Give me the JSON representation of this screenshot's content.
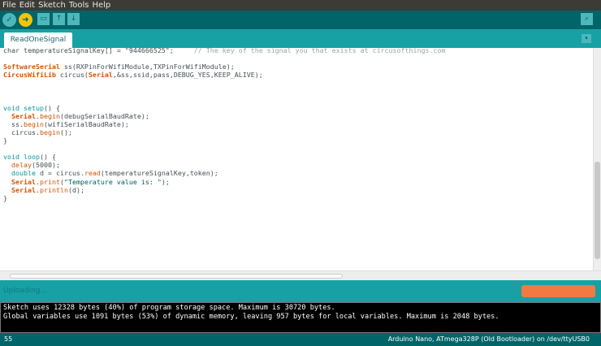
{
  "menu": [
    "File",
    "Edit",
    "Sketch",
    "Tools",
    "Help"
  ],
  "toolbar": {
    "verify": "✓",
    "upload": "➜",
    "new": "▭",
    "open": "↑",
    "save": "↓",
    "serial": "⌕"
  },
  "tab": {
    "label": "ReadOneSignal",
    "menu": "▾"
  },
  "code": [
    [
      {
        "t": "char temperatureSignalKey[] = \"944666525\";     ",
        "c": ""
      },
      {
        "t": "// The key of the signal you that exists at circusofthings.com",
        "c": "cm"
      }
    ],
    [],
    [
      {
        "t": "SoftwareSerial",
        "c": "cl"
      },
      {
        "t": " ss(RXPinForWifiModule,TXPinForWifiModule);",
        "c": ""
      }
    ],
    [
      {
        "t": "CircusWifiLib",
        "c": "cl"
      },
      {
        "t": " circus(",
        "c": ""
      },
      {
        "t": "Serial",
        "c": "cl"
      },
      {
        "t": ",&ss,ssid,pass,DEBUG_YES,KEEP_ALIVE);",
        "c": ""
      }
    ],
    [],
    [],
    [],
    [
      {
        "t": "void",
        "c": "kw"
      },
      {
        "t": " ",
        "c": ""
      },
      {
        "t": "setup",
        "c": "kw"
      },
      {
        "t": "() {",
        "c": ""
      }
    ],
    [
      {
        "t": "  ",
        "c": ""
      },
      {
        "t": "Serial",
        "c": "cl"
      },
      {
        "t": ".",
        "c": ""
      },
      {
        "t": "begin",
        "c": "fn"
      },
      {
        "t": "(debugSerialBaudRate);",
        "c": ""
      }
    ],
    [
      {
        "t": "  ss.",
        "c": ""
      },
      {
        "t": "begin",
        "c": "fn"
      },
      {
        "t": "(wifiSerialBaudRate);",
        "c": ""
      }
    ],
    [
      {
        "t": "  circus.",
        "c": ""
      },
      {
        "t": "begin",
        "c": "fn"
      },
      {
        "t": "();",
        "c": ""
      }
    ],
    [
      {
        "t": "}",
        "c": ""
      }
    ],
    [],
    [
      {
        "t": "void",
        "c": "kw"
      },
      {
        "t": " ",
        "c": ""
      },
      {
        "t": "loop",
        "c": "kw"
      },
      {
        "t": "() {",
        "c": ""
      }
    ],
    [
      {
        "t": "  ",
        "c": ""
      },
      {
        "t": "delay",
        "c": "fn"
      },
      {
        "t": "(5000);",
        "c": ""
      }
    ],
    [
      {
        "t": "  ",
        "c": ""
      },
      {
        "t": "double",
        "c": "kw"
      },
      {
        "t": " d = circus.",
        "c": ""
      },
      {
        "t": "read",
        "c": "fn"
      },
      {
        "t": "(temperatureSignalKey,token);",
        "c": ""
      }
    ],
    [
      {
        "t": "  ",
        "c": ""
      },
      {
        "t": "Serial",
        "c": "cl"
      },
      {
        "t": ".",
        "c": ""
      },
      {
        "t": "print",
        "c": "fn"
      },
      {
        "t": "(",
        "c": ""
      },
      {
        "t": "\"Temperature value is: \"",
        "c": "st"
      },
      {
        "t": ");",
        "c": ""
      }
    ],
    [
      {
        "t": "  ",
        "c": ""
      },
      {
        "t": "Serial",
        "c": "cl"
      },
      {
        "t": ".",
        "c": ""
      },
      {
        "t": "println",
        "c": "fn"
      },
      {
        "t": "(d);",
        "c": ""
      }
    ],
    [
      {
        "t": "}",
        "c": ""
      }
    ]
  ],
  "status": {
    "text": "Uploading...",
    "progress": 0
  },
  "console": [
    "Sketch uses 12328 bytes (40%) of program storage space. Maximum is 30720 bytes.",
    "Global variables use 1091 bytes (53%) of dynamic memory, leaving 957 bytes for local variables. Maximum is 2048 bytes."
  ],
  "footer": {
    "line": "55",
    "board": "Arduino Nano, ATmega328P (Old Bootloader) on /dev/ttyUSB0"
  }
}
